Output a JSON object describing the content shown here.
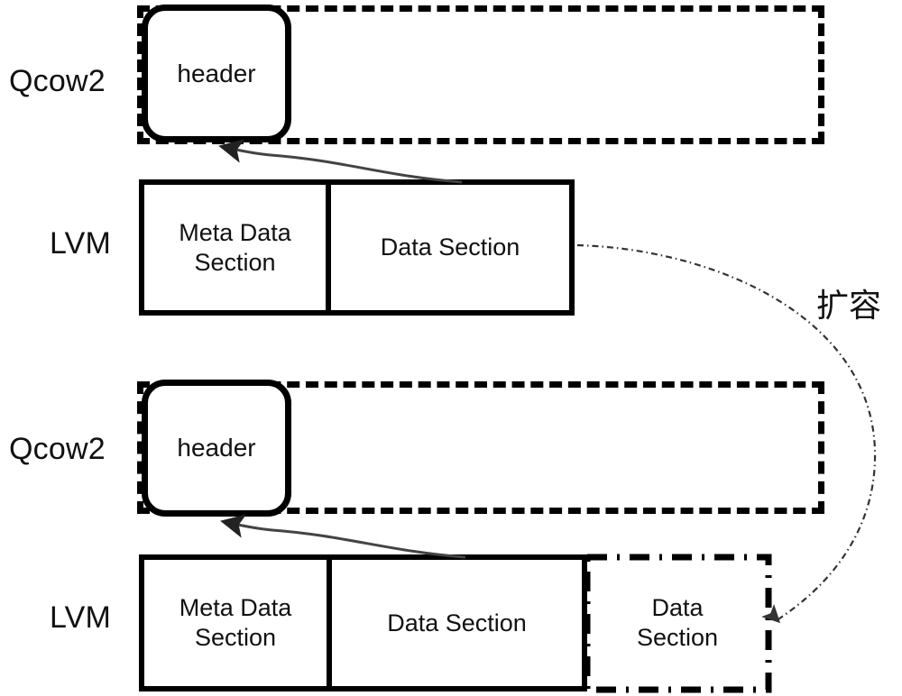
{
  "diagram": {
    "title_visible": false,
    "background_color": "#ffffff",
    "stroke_color": "#000000",
    "rows": [
      {
        "id": "before",
        "layer_label_qcow": "Qcow2",
        "layer_label_lvm": "LVM",
        "header_label": "header",
        "lvm_cells": [
          {
            "label": "Meta Data\nSection",
            "line1": "Meta Data",
            "line2": "Section"
          },
          {
            "label": "Data Section",
            "line1": "Data Section",
            "line2": ""
          }
        ],
        "has_expansion": false
      },
      {
        "id": "after",
        "layer_label_qcow": "Qcow2",
        "layer_label_lvm": "LVM",
        "header_label": "header",
        "lvm_cells": [
          {
            "label": "Meta Data\nSection",
            "line1": "Meta Data",
            "line2": "Section"
          },
          {
            "label": "Data Section",
            "line1": "Data Section",
            "line2": ""
          }
        ],
        "has_expansion": true,
        "expansion_cell": {
          "line1": "Data",
          "line2": "Section"
        }
      }
    ],
    "annotation": {
      "expand_label": "扩容"
    },
    "icons": {
      "header_to_data_arrow": "curved-arrow-icon",
      "expansion_arrow": "dotted-curved-arrow-icon"
    }
  }
}
